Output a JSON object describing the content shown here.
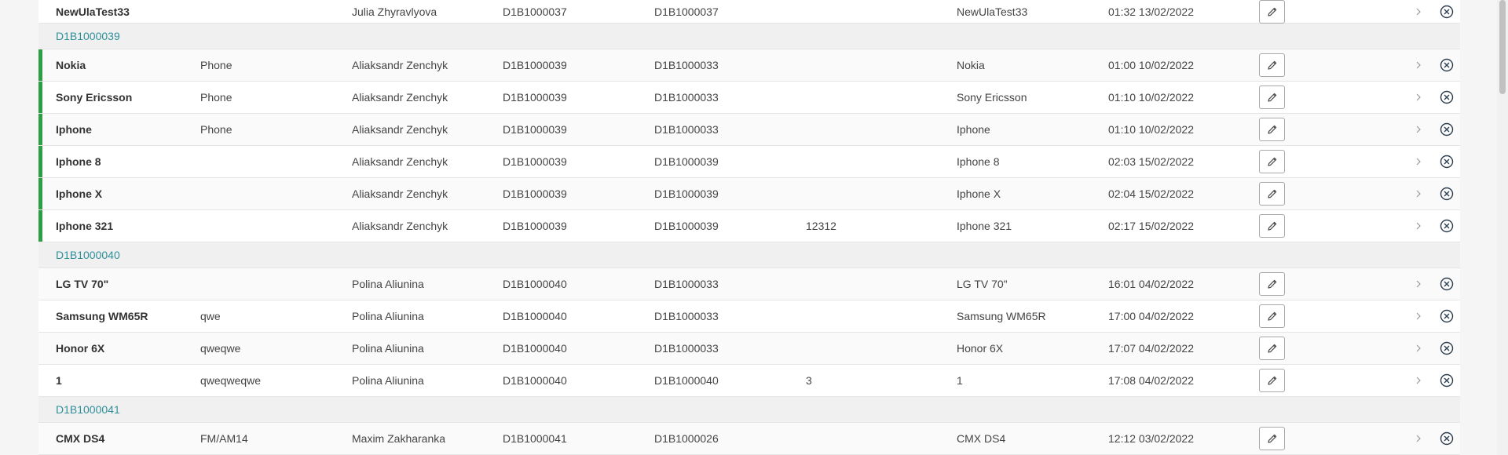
{
  "colors": {
    "accent_green": "#2e9e44",
    "group_link": "#2f8f99"
  },
  "icons": {
    "edit": "pencil-icon",
    "expand": "chevron-right-icon",
    "remove": "close-circle-icon"
  },
  "rows": [
    {
      "kind": "item",
      "flag": false,
      "name": "NewUlaTest33",
      "type": "",
      "owner": "Julia Zhyravlyova",
      "id1": "D1B1000037",
      "id2": "D1B1000037",
      "num": "",
      "alias": "NewUlaTest33",
      "date": "01:32 13/02/2022"
    },
    {
      "kind": "group",
      "label": "D1B1000039"
    },
    {
      "kind": "item",
      "flag": true,
      "name": "Nokia",
      "type": "Phone",
      "owner": "Aliaksandr Zenchyk",
      "id1": "D1B1000039",
      "id2": "D1B1000033",
      "num": "",
      "alias": "Nokia",
      "date": "01:00 10/02/2022"
    },
    {
      "kind": "item",
      "flag": true,
      "name": "Sony Ericsson",
      "type": "Phone",
      "owner": "Aliaksandr Zenchyk",
      "id1": "D1B1000039",
      "id2": "D1B1000033",
      "num": "",
      "alias": "Sony Ericsson",
      "date": "01:10 10/02/2022"
    },
    {
      "kind": "item",
      "flag": true,
      "name": "Iphone",
      "type": "Phone",
      "owner": "Aliaksandr Zenchyk",
      "id1": "D1B1000039",
      "id2": "D1B1000033",
      "num": "",
      "alias": "Iphone",
      "date": "01:10 10/02/2022"
    },
    {
      "kind": "item",
      "flag": true,
      "name": "Iphone 8",
      "type": "",
      "owner": "Aliaksandr Zenchyk",
      "id1": "D1B1000039",
      "id2": "D1B1000039",
      "num": "",
      "alias": "Iphone 8",
      "date": "02:03 15/02/2022"
    },
    {
      "kind": "item",
      "flag": true,
      "name": "Iphone X",
      "type": "",
      "owner": "Aliaksandr Zenchyk",
      "id1": "D1B1000039",
      "id2": "D1B1000039",
      "num": "",
      "alias": "Iphone X",
      "date": "02:04 15/02/2022"
    },
    {
      "kind": "item",
      "flag": true,
      "name": "Iphone 321",
      "type": "",
      "owner": "Aliaksandr Zenchyk",
      "id1": "D1B1000039",
      "id2": "D1B1000039",
      "num": "12312",
      "alias": "Iphone 321",
      "date": "02:17 15/02/2022"
    },
    {
      "kind": "group",
      "label": "D1B1000040"
    },
    {
      "kind": "item",
      "flag": false,
      "name": "LG TV 70\"",
      "type": "",
      "owner": "Polina Aliunina",
      "id1": "D1B1000040",
      "id2": "D1B1000033",
      "num": "",
      "alias": "LG TV 70\"",
      "date": "16:01 04/02/2022"
    },
    {
      "kind": "item",
      "flag": false,
      "name": "Samsung WM65R",
      "type": "qwe",
      "owner": "Polina Aliunina",
      "id1": "D1B1000040",
      "id2": "D1B1000033",
      "num": "",
      "alias": "Samsung WM65R",
      "date": "17:00 04/02/2022"
    },
    {
      "kind": "item",
      "flag": false,
      "name": "Honor 6X",
      "type": "qweqwe",
      "owner": "Polina Aliunina",
      "id1": "D1B1000040",
      "id2": "D1B1000033",
      "num": "",
      "alias": "Honor 6X",
      "date": "17:07 04/02/2022"
    },
    {
      "kind": "item",
      "flag": false,
      "name": "1",
      "type": "qweqweqwe",
      "owner": "Polina Aliunina",
      "id1": "D1B1000040",
      "id2": "D1B1000040",
      "num": "3",
      "alias": "1",
      "date": "17:08 04/02/2022"
    },
    {
      "kind": "group",
      "label": "D1B1000041"
    },
    {
      "kind": "item",
      "flag": false,
      "name": "CMX DS4",
      "type": "FM/AM14",
      "owner": "Maxim Zakharanka",
      "id1": "D1B1000041",
      "id2": "D1B1000026",
      "num": "",
      "alias": "CMX DS4",
      "date": "12:12 03/02/2022"
    }
  ]
}
